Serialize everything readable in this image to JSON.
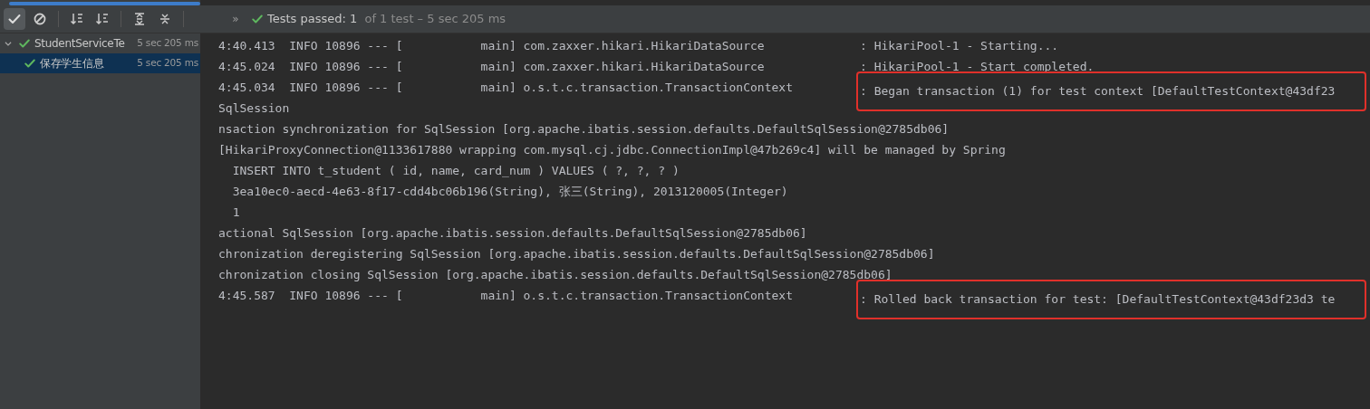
{
  "progress": {
    "level": 1
  },
  "toolbar": {
    "buttons": [
      {
        "kind": "check",
        "selected": true
      },
      {
        "kind": "block",
        "selected": false
      },
      {
        "kind": "sort-alpha",
        "selected": false
      },
      {
        "kind": "sort-duration",
        "selected": false
      },
      {
        "kind": "expand",
        "selected": false
      },
      {
        "kind": "collapse",
        "selected": false
      }
    ],
    "more": "»",
    "status": {
      "passed": "Tests passed: 1",
      "detail": " of 1 test – 5 sec 205 ms"
    }
  },
  "tree": [
    {
      "name": "StudentServiceTe",
      "time": "5 sec 205 ms",
      "passed": true,
      "expanded": true,
      "selected": false,
      "children": [
        {
          "name": "保存学生信息",
          "time": "5 sec 205 ms",
          "passed": true,
          "selected": true
        }
      ]
    }
  ],
  "console": [
    {
      "kind": "log",
      "prefix": "4:40.413  INFO 10896 --- [           main] com.zaxxer.hikari.HikariDataSource",
      "message": ": HikariPool-1 - Starting...",
      "highlighted": false
    },
    {
      "kind": "log",
      "prefix": "4:45.024  INFO 10896 --- [           main] com.zaxxer.hikari.HikariDataSource",
      "message": ": HikariPool-1 - Start completed.",
      "highlighted": false
    },
    {
      "kind": "log",
      "prefix": "4:45.034  INFO 10896 --- [           main] o.s.t.c.transaction.TransactionContext",
      "message": ": Began transaction (1) for test context [DefaultTestContext@43df23",
      "highlighted": true
    },
    {
      "kind": "text",
      "text": "SqlSession"
    },
    {
      "kind": "text",
      "text": "nsaction synchronization for SqlSession [org.apache.ibatis.session.defaults.DefaultSqlSession@2785db06]"
    },
    {
      "kind": "text",
      "text": "[HikariProxyConnection@1133617880 wrapping com.mysql.cj.jdbc.ConnectionImpl@47b269c4] will be managed by Spring"
    },
    {
      "kind": "text",
      "text": "  INSERT INTO t_student ( id, name, card_num ) VALUES ( ?, ?, ? )"
    },
    {
      "kind": "text",
      "text": "  3ea10ec0-aecd-4e63-8f17-cdd4bc06b196(String), 张三(String), 2013120005(Integer)"
    },
    {
      "kind": "text",
      "text": "  1"
    },
    {
      "kind": "text",
      "text": "actional SqlSession [org.apache.ibatis.session.defaults.DefaultSqlSession@2785db06]"
    },
    {
      "kind": "text",
      "text": "chronization deregistering SqlSession [org.apache.ibatis.session.defaults.DefaultSqlSession@2785db06]"
    },
    {
      "kind": "text",
      "text": "chronization closing SqlSession [org.apache.ibatis.session.defaults.DefaultSqlSession@2785db06]"
    },
    {
      "kind": "log",
      "prefix": "4:45.587  INFO 10896 --- [           main] o.s.t.c.transaction.TransactionContext",
      "message": ": Rolled back transaction for test: [DefaultTestContext@43df23d3 te",
      "highlighted": true
    }
  ]
}
